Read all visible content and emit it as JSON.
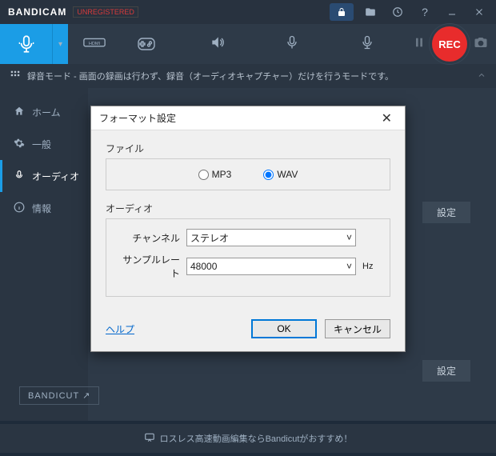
{
  "titlebar": {
    "brand": "BANDICAM",
    "unregistered": "UNREGISTERED"
  },
  "toolbar": {
    "rec_label": "REC"
  },
  "modebar": {
    "text": "録音モード - 画面の録画は行わず、録音（オーディオキャプチャー）だけを行うモードです。"
  },
  "sidebar": {
    "items": [
      {
        "icon": "home",
        "label": "ホーム"
      },
      {
        "icon": "gear",
        "label": "一般"
      },
      {
        "icon": "audio",
        "label": "オーディオ"
      },
      {
        "icon": "info",
        "label": "情報"
      }
    ]
  },
  "main": {
    "settings_btn_1": "設定",
    "settings_btn_2": "設定"
  },
  "bandicut": "BANDICUT ↗",
  "footer": {
    "message": "ロスレス高速動画編集ならBandicutがおすすめ！"
  },
  "dialog": {
    "title": "フォーマット設定",
    "file_legend": "ファイル",
    "mp3_label": "MP3",
    "wav_label": "WAV",
    "audio_legend": "オーディオ",
    "channel_label": "チャンネル",
    "channel_value": "ステレオ",
    "samplerate_label": "サンプルレート",
    "samplerate_value": "48000",
    "samplerate_unit": "Hz",
    "help": "ヘルプ",
    "ok": "OK",
    "cancel": "キャンセル",
    "selected_format": "WAV"
  }
}
